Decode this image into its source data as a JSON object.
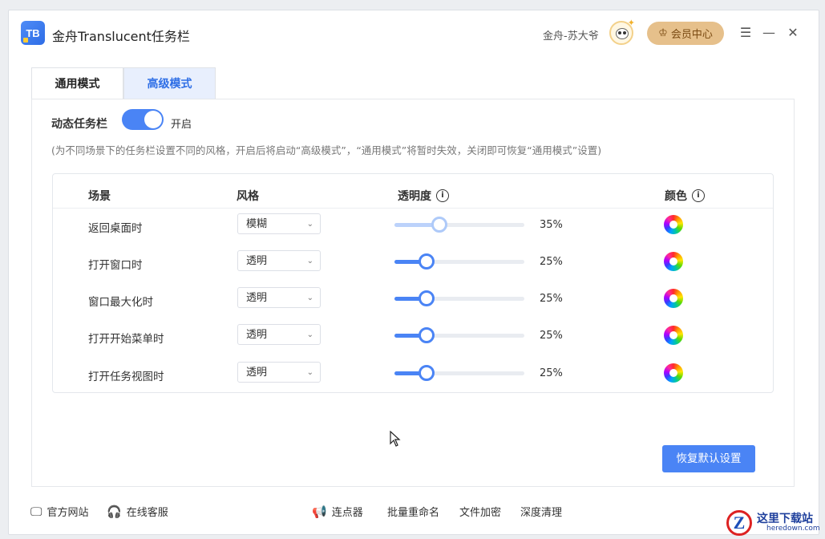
{
  "app": {
    "title": "金舟Translucent任务栏",
    "logo_text": "TB",
    "username": "金舟-苏大爷",
    "vip_label": "会员中心",
    "controls": {
      "menu": "☰",
      "minimize": "—",
      "close": "✕"
    }
  },
  "tabs": [
    {
      "label": "通用模式",
      "active": false
    },
    {
      "label": "高级模式",
      "active": true
    }
  ],
  "dynamic": {
    "label": "动态任务栏",
    "state": "开启",
    "on": true,
    "note": "(为不同场景下的任务栏设置不同的风格，开启后将启动“高级模式”，“通用模式”将暂时失效，关闭即可恢复“通用模式”设置)"
  },
  "table": {
    "headers": {
      "scene": "场景",
      "style": "风格",
      "opacity": "透明度",
      "color": "颜色"
    },
    "rows": [
      {
        "scene": "返回桌面时",
        "style": "模糊",
        "opacity": 35,
        "opacity_label": "35%"
      },
      {
        "scene": "打开窗口时",
        "style": "透明",
        "opacity": 25,
        "opacity_label": "25%"
      },
      {
        "scene": "窗口最大化时",
        "style": "透明",
        "opacity": 25,
        "opacity_label": "25%"
      },
      {
        "scene": "打开开始菜单时",
        "style": "透明",
        "opacity": 25,
        "opacity_label": "25%"
      },
      {
        "scene": "打开任务视图时",
        "style": "透明",
        "opacity": 25,
        "opacity_label": "25%"
      }
    ]
  },
  "restore_button": "恢复默认设置",
  "footer": {
    "website": "官方网站",
    "support": "在线客服",
    "clicker": "连点器",
    "rename": "批量重命名",
    "encrypt": "文件加密",
    "clean": "深度清理"
  },
  "watermark": {
    "logo": "Z",
    "title": "这里下载站",
    "sub": "heredown.com"
  },
  "colors": {
    "accent": "#4a84f5",
    "vip_bg": "#e6c08b",
    "tab_active_bg": "#e8effd"
  }
}
